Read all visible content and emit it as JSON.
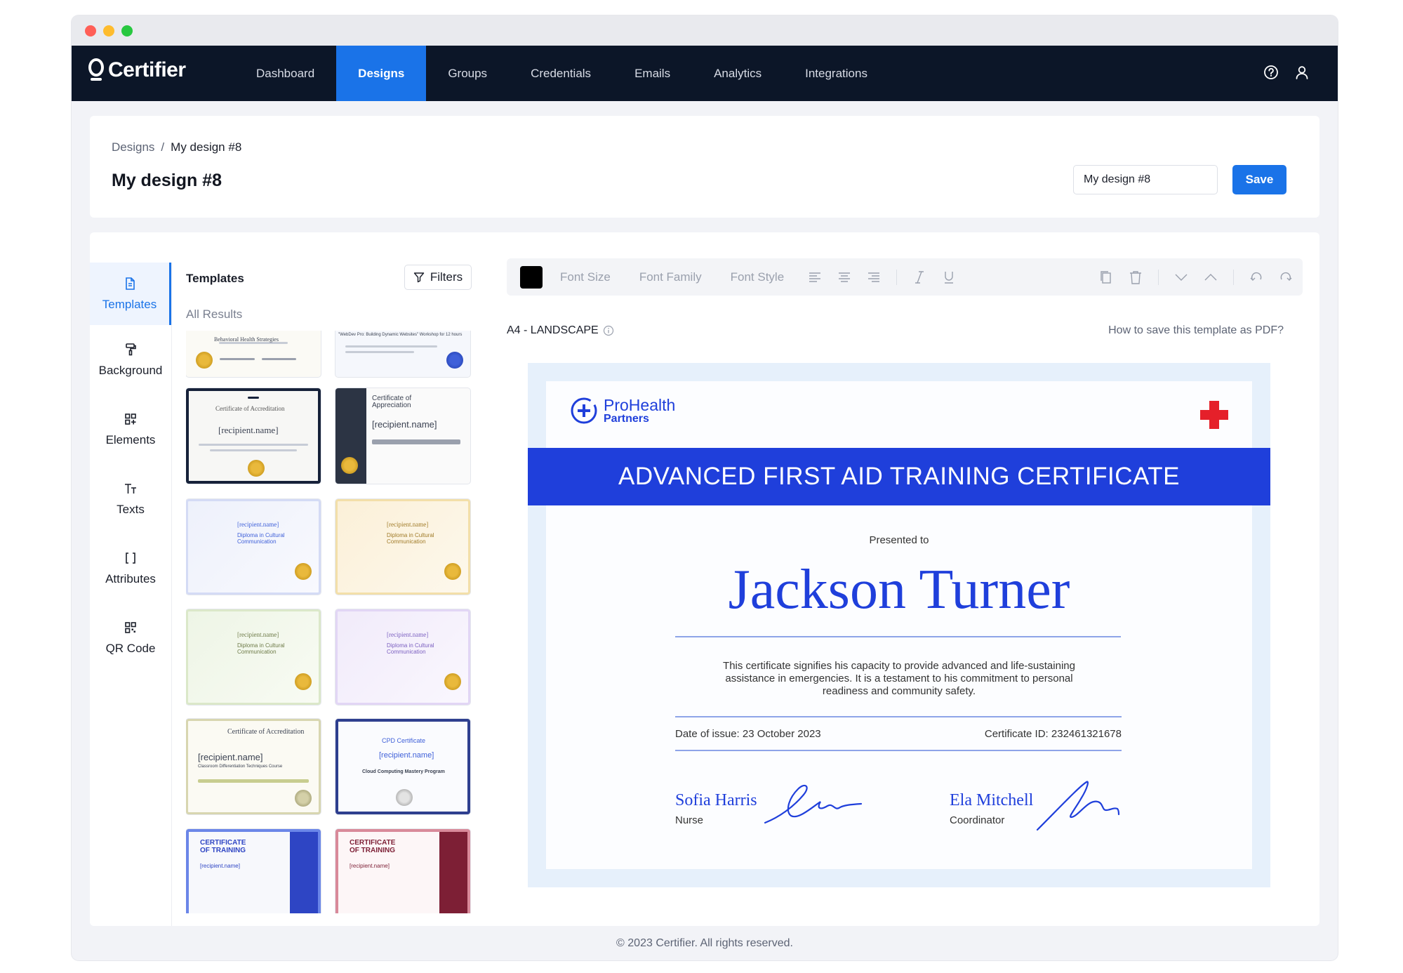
{
  "app": {
    "logo": "Certifier"
  },
  "nav": {
    "items": [
      {
        "label": "Dashboard"
      },
      {
        "label": "Designs"
      },
      {
        "label": "Groups"
      },
      {
        "label": "Credentials"
      },
      {
        "label": "Emails"
      },
      {
        "label": "Analytics"
      },
      {
        "label": "Integrations"
      }
    ],
    "active": "Designs",
    "icons": [
      "help-icon",
      "user-icon"
    ]
  },
  "header": {
    "breadcrumb_root": "Designs",
    "breadcrumb_sep": "/",
    "breadcrumb_current": "My design #8",
    "title": "My design #8",
    "name_value": "My design #8",
    "save_label": "Save"
  },
  "sidebar": {
    "tabs": [
      {
        "label": "Templates",
        "icon": "template-icon"
      },
      {
        "label": "Background",
        "icon": "paint-roller-icon"
      },
      {
        "label": "Elements",
        "icon": "elements-icon"
      },
      {
        "label": "Texts",
        "icon": "text-icon"
      },
      {
        "label": "Attributes",
        "icon": "brackets-icon"
      },
      {
        "label": "QR Code",
        "icon": "qr-code-icon"
      }
    ],
    "active": "Templates"
  },
  "templates": {
    "title": "Templates",
    "filters_label": "Filters",
    "results_label": "All Results",
    "thumbs": [
      {
        "text": "Behavioral Health Strategies",
        "style": "gold-partial"
      },
      {
        "text": "\"WebDev Pro: Building Dynamic Websites\" Workshop for 12 hours",
        "style": "blue-partial"
      },
      {
        "text": "Certificate of Accreditation",
        "name": "[recipient.name]",
        "style": "navy-border"
      },
      {
        "text": "Certificate of Appreciation",
        "name": "[recipient.name]",
        "style": "dark-side"
      },
      {
        "text": "Diploma in Cultural Communication",
        "name": "[recipient.name]",
        "style": "blue-wave"
      },
      {
        "text": "Diploma in Cultural Communication",
        "name": "[recipient.name]",
        "style": "gold-wave"
      },
      {
        "text": "Diploma in Cultural Communication",
        "name": "[recipient.name]",
        "style": "green-wave"
      },
      {
        "text": "Diploma in Cultural Communication",
        "name": "[recipient.name]",
        "style": "purple-wave"
      },
      {
        "text": "Certificate of Accreditation",
        "name": "[recipient.name]",
        "sub": "Classroom Differentiation Techniques Course",
        "style": "olive-border"
      },
      {
        "text": "CPD Certificate",
        "name": "[recipient.name]",
        "sub": "Cloud Computing Mastery Program",
        "style": "blue-border"
      },
      {
        "text": "CERTIFICATE OF TRAINING",
        "name": "[recipient.name]",
        "style": "blue-training"
      },
      {
        "text": "CERTIFICATE OF TRAINING",
        "name": "[recipient.name]",
        "style": "maroon-training"
      }
    ]
  },
  "toolbar": {
    "color": "#000000",
    "font_size": "Font Size",
    "font_family": "Font Family",
    "font_style": "Font Style",
    "icons": [
      "align-left-icon",
      "align-center-icon",
      "align-right-icon",
      "italic-icon",
      "underline-icon",
      "copy-icon",
      "trash-icon",
      "chevron-down-icon",
      "chevron-up-icon",
      "undo-icon",
      "redo-icon"
    ]
  },
  "canvas": {
    "format": "A4 - LANDSCAPE",
    "help_link": "How to save this template as PDF?"
  },
  "certificate": {
    "logo_line1": "ProHealth",
    "logo_line2": "Partners",
    "banner": "ADVANCED FIRST AID TRAINING CERTIFICATE",
    "presented_to": "Presented to",
    "recipient": "Jackson Turner",
    "description": "This certificate signifies his capacity to provide advanced and life-sustaining assistance in emergencies. It is a testament to his commitment to personal readiness and community safety.",
    "date_of_issue": "Date of issue: 23 October 2023",
    "certificate_id": "Certificate ID: 232461321678",
    "signer1_name": "Sofia Harris",
    "signer1_role": "Nurse",
    "signer2_name": "Ela Mitchell",
    "signer2_role": "Coordinator",
    "accent_color": "#1f3fdb",
    "cross_color": "#e5202a"
  },
  "footer": {
    "text": "© 2023 Certifier. All rights reserved."
  },
  "colors": {
    "brand_blue": "#1a73e8",
    "nav_bg": "#0c1628"
  }
}
